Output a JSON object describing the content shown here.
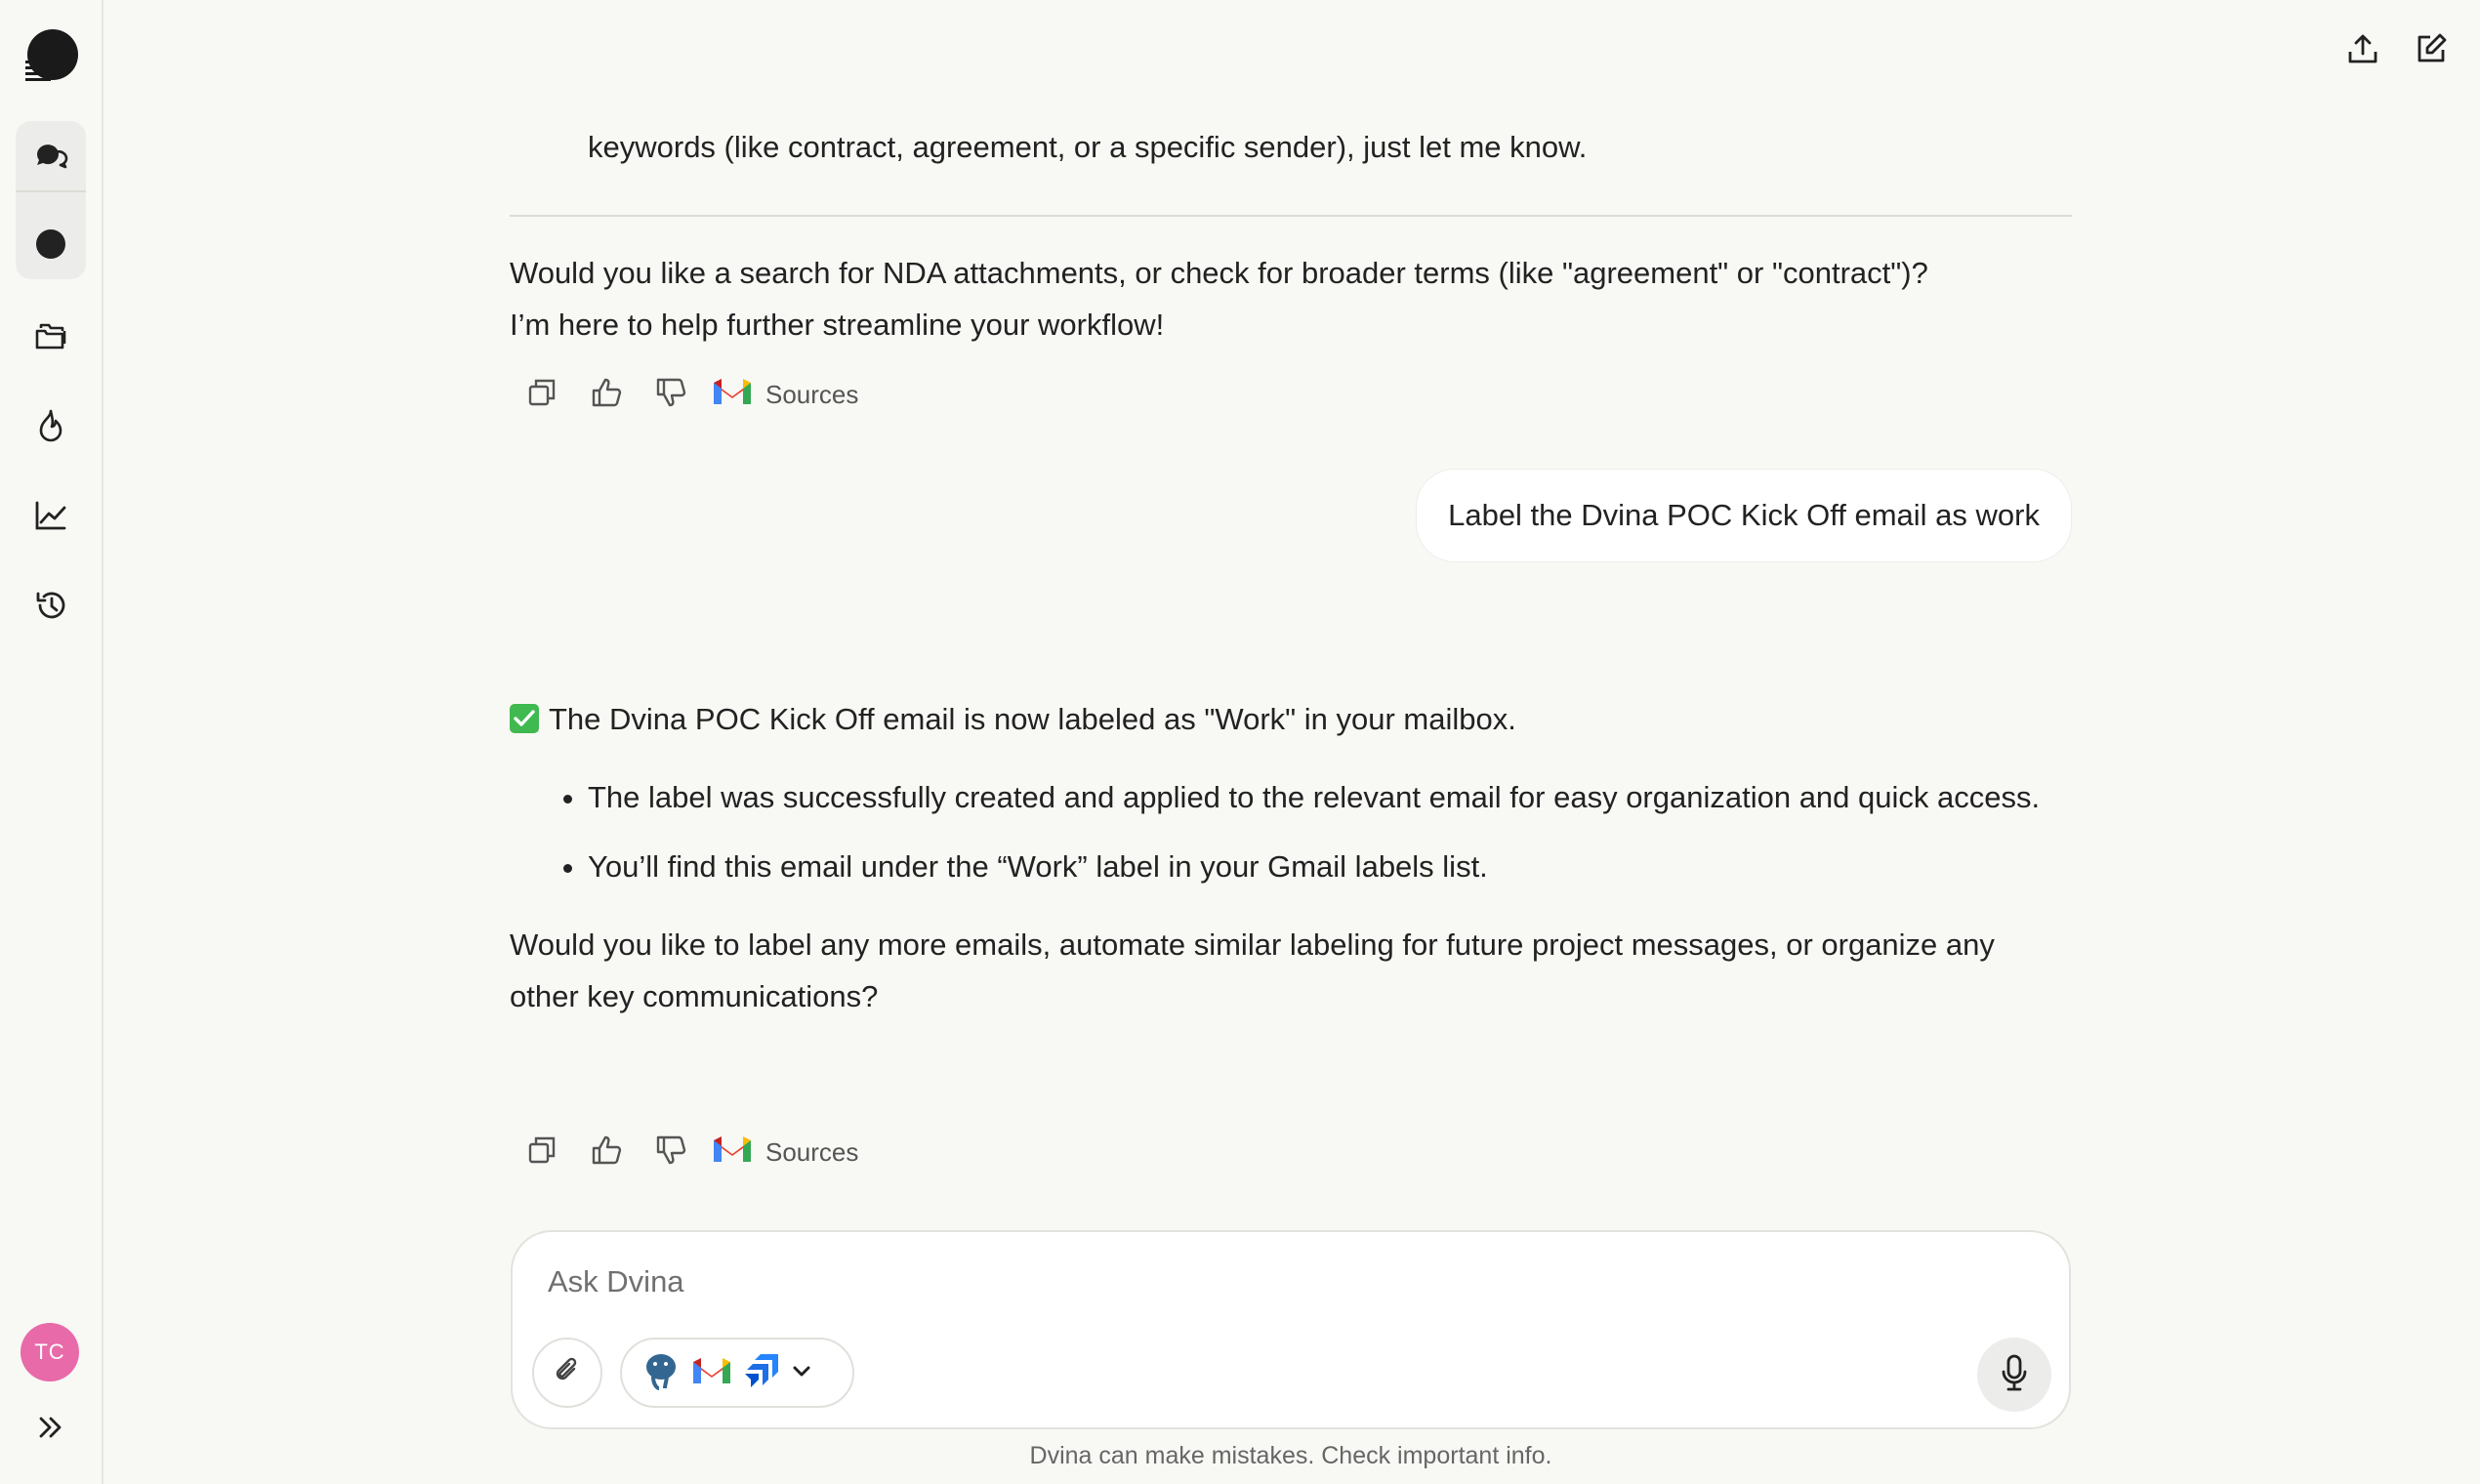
{
  "app": {
    "name": "Dvina"
  },
  "conversation": {
    "prev_tail": "keywords (like contract, agreement, or a specific sender), just let me know.",
    "prev_followup_line1": "Would you like a search for NDA attachments, or check for broader terms (like \"agreement\" or \"contract\")?",
    "prev_followup_line2": "I’m here to help further streamline your workflow!",
    "sources_label": "Sources",
    "user_message": "Label the Dvina POC Kick Off email as work",
    "reply_summary": "The Dvina POC Kick Off email is now labeled as \"Work\" in your mailbox.",
    "reply_bullets": [
      "The label was successfully created and applied to the relevant email for easy organization and quick access.",
      "You’ll find this email under the “Work” label in your Gmail labels list."
    ],
    "reply_followup": "Would you like to label any more emails, automate similar labeling for future project messages, or organize any other key communications?"
  },
  "sidebar": {
    "items": [
      "chat-icon",
      "circle-icon",
      "folders-icon",
      "flame-icon",
      "chart-icon",
      "history-icon"
    ],
    "avatar_initials": "TC"
  },
  "composer": {
    "placeholder": "Ask Dvina",
    "tools": [
      "postgresql-icon",
      "gmail-icon",
      "jira-icon"
    ]
  },
  "footer": {
    "disclaimer": "Dvina can make mistakes. Check important info."
  },
  "colors": {
    "accent_avatar": "#e86aa8",
    "check_green": "#3fb950",
    "background": "#f8f8f5"
  }
}
